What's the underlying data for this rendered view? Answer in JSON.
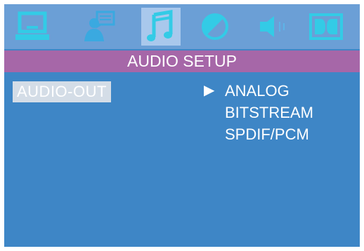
{
  "icons": [
    {
      "name": "display-icon",
      "active": false
    },
    {
      "name": "language-icon",
      "active": false
    },
    {
      "name": "audio-icon",
      "active": true
    },
    {
      "name": "video-icon",
      "active": false
    },
    {
      "name": "speaker-icon",
      "active": false
    },
    {
      "name": "dolby-icon",
      "active": false
    }
  ],
  "title": "AUDIO SETUP",
  "menu": {
    "label": "AUDIO-OUT"
  },
  "options": [
    {
      "label": "ANALOG",
      "selected": true,
      "marker": "▶"
    },
    {
      "label": "BITSTREAM",
      "selected": false
    },
    {
      "label": "SPDIF/PCM",
      "selected": false
    }
  ],
  "colors": {
    "background": "#3e86c6",
    "icon_bar": "#6b9fd6",
    "title_bar": "#a667a8",
    "highlight": "#d4dde7",
    "icon_cyan": "#33cbe6"
  }
}
